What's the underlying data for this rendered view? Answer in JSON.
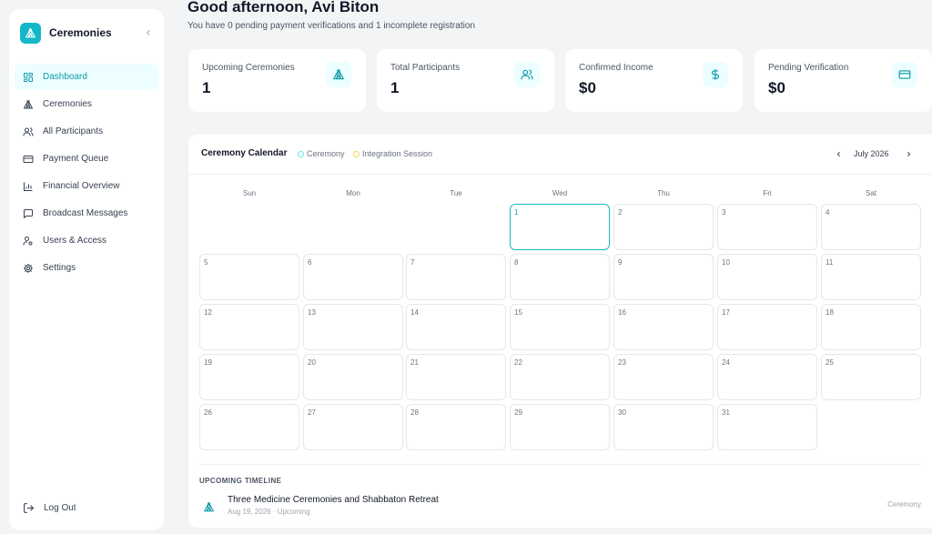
{
  "sidebar": {
    "brand": "Ceremonies",
    "items": [
      {
        "label": "Dashboard",
        "icon": "dashboard-icon",
        "active": true
      },
      {
        "label": "Ceremonies",
        "icon": "tent-icon"
      },
      {
        "label": "All Participants",
        "icon": "users-icon"
      },
      {
        "label": "Payment Queue",
        "icon": "credit-card-icon"
      },
      {
        "label": "Financial Overview",
        "icon": "bar-chart-icon"
      },
      {
        "label": "Broadcast Messages",
        "icon": "message-icon"
      },
      {
        "label": "Users & Access",
        "icon": "user-key-icon"
      },
      {
        "label": "Settings",
        "icon": "gear-icon"
      }
    ],
    "logout": "Log Out"
  },
  "header": {
    "greeting": "Good afternoon, Avi Biton",
    "subline": "You have 0 pending payment verifications and 1 incomplete registration"
  },
  "stats": [
    {
      "label": "Upcoming Ceremonies",
      "value": "1",
      "icon": "tent-icon"
    },
    {
      "label": "Total Participants",
      "value": "1",
      "icon": "users-icon"
    },
    {
      "label": "Confirmed Income",
      "value": "$0",
      "icon": "dollar-icon"
    },
    {
      "label": "Pending Verification",
      "value": "$0",
      "icon": "credit-card-icon"
    }
  ],
  "calendar": {
    "title": "Ceremony Calendar",
    "legend": [
      {
        "label": "Ceremony",
        "color": "#67e8f9"
      },
      {
        "label": "Integration Session",
        "color": "#fcd34d"
      }
    ],
    "month": "July 2026",
    "weekdays": [
      "Sun",
      "Mon",
      "Tue",
      "Wed",
      "Thu",
      "Fri",
      "Sat"
    ],
    "first_weekday": 3,
    "days_in_month": 31,
    "today": 1
  },
  "timeline": {
    "title": "UPCOMING TIMELINE",
    "items": [
      {
        "name": "Three Medicine Ceremonies and Shabbaton Retreat",
        "meta": "Aug 19, 2026 · Upcoming",
        "type": "Ceremony"
      }
    ]
  },
  "colors": {
    "accent": "#14b8c8",
    "accent_soft": "#ecfeff",
    "background": "#f3f4f6"
  }
}
